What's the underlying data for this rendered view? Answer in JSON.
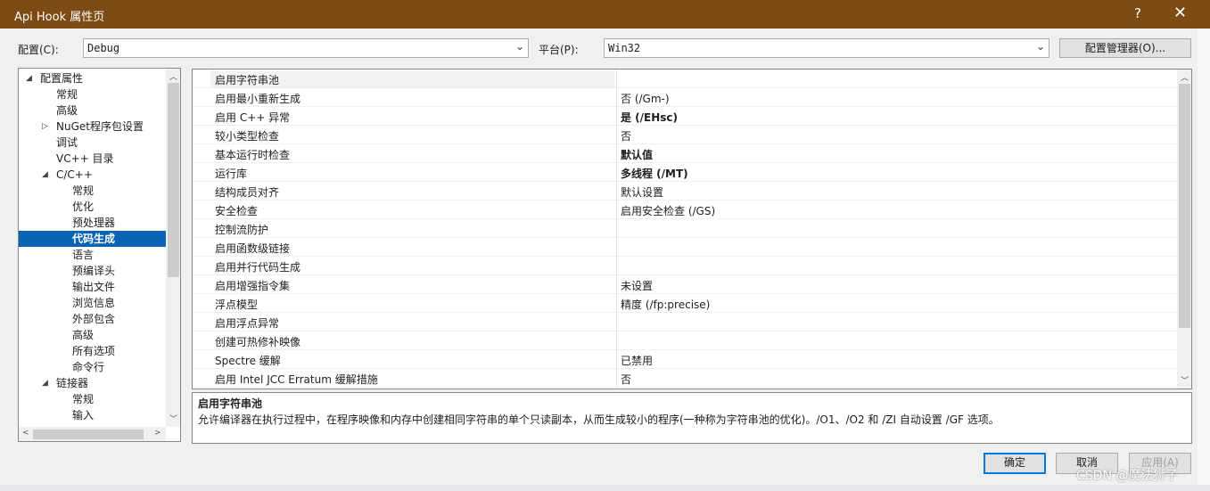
{
  "window": {
    "title": "Api Hook 属性页",
    "help": "?",
    "close": "✕"
  },
  "config": {
    "config_label": "配置(C):",
    "config_value": "Debug",
    "platform_label": "平台(P):",
    "platform_value": "Win32",
    "manager_button": "配置管理器(O)..."
  },
  "tree": {
    "items": [
      {
        "label": "配置属性",
        "toggle": "◢"
      },
      {
        "label": "常规",
        "toggle": ""
      },
      {
        "label": "高级",
        "toggle": ""
      },
      {
        "label": "NuGet程序包设置",
        "toggle": "▷"
      },
      {
        "label": "调试",
        "toggle": ""
      },
      {
        "label": "VC++ 目录",
        "toggle": ""
      },
      {
        "label": "C/C++",
        "toggle": "◢"
      },
      {
        "label": "常规",
        "toggle": ""
      },
      {
        "label": "优化",
        "toggle": ""
      },
      {
        "label": "预处理器",
        "toggle": ""
      },
      {
        "label": "代码生成",
        "toggle": ""
      },
      {
        "label": "语言",
        "toggle": ""
      },
      {
        "label": "预编译头",
        "toggle": ""
      },
      {
        "label": "输出文件",
        "toggle": ""
      },
      {
        "label": "浏览信息",
        "toggle": ""
      },
      {
        "label": "外部包含",
        "toggle": ""
      },
      {
        "label": "高级",
        "toggle": ""
      },
      {
        "label": "所有选项",
        "toggle": ""
      },
      {
        "label": "命令行",
        "toggle": ""
      },
      {
        "label": "链接器",
        "toggle": "◢"
      },
      {
        "label": "常规",
        "toggle": ""
      },
      {
        "label": "输入",
        "toggle": ""
      }
    ],
    "selected_index": 10
  },
  "properties": [
    {
      "name": "启用字符串池",
      "value": ""
    },
    {
      "name": "启用最小重新生成",
      "value": "否 (/Gm-)"
    },
    {
      "name": "启用 C++ 异常",
      "value": "是 (/EHsc)"
    },
    {
      "name": "较小类型检查",
      "value": "否"
    },
    {
      "name": "基本运行时检查",
      "value": "默认值"
    },
    {
      "name": "运行库",
      "value": "多线程 (/MT)"
    },
    {
      "name": "结构成员对齐",
      "value": "默认设置"
    },
    {
      "name": "安全检查",
      "value": "启用安全检查 (/GS)"
    },
    {
      "name": "控制流防护",
      "value": ""
    },
    {
      "name": "启用函数级链接",
      "value": ""
    },
    {
      "name": "启用并行代码生成",
      "value": ""
    },
    {
      "name": "启用增强指令集",
      "value": "未设置"
    },
    {
      "name": "浮点模型",
      "value": "精度 (/fp:precise)"
    },
    {
      "name": "启用浮点异常",
      "value": ""
    },
    {
      "name": "创建可热修补映像",
      "value": ""
    },
    {
      "name": "Spectre 缓解",
      "value": "已禁用"
    },
    {
      "name": "启用 Intel JCC Erratum 缓解措施",
      "value": "否"
    }
  ],
  "description": {
    "title": "启用字符串池",
    "body": "允许编译器在执行过程中，在程序映像和内存中创建相同字符串的单个只读副本，从而生成较小的程序(一种称为字符串池的优化)。/O1、/O2 和 /ZI 自动设置 /GF 选项。"
  },
  "buttons": {
    "ok": "确定",
    "cancel": "取消",
    "apply": "应用(A)"
  },
  "watermark": "CSDN @魔法狮子",
  "colors": {
    "titlebar": "#7e4b14",
    "selection": "#0a64b4",
    "focus_border": "#0078d7"
  }
}
